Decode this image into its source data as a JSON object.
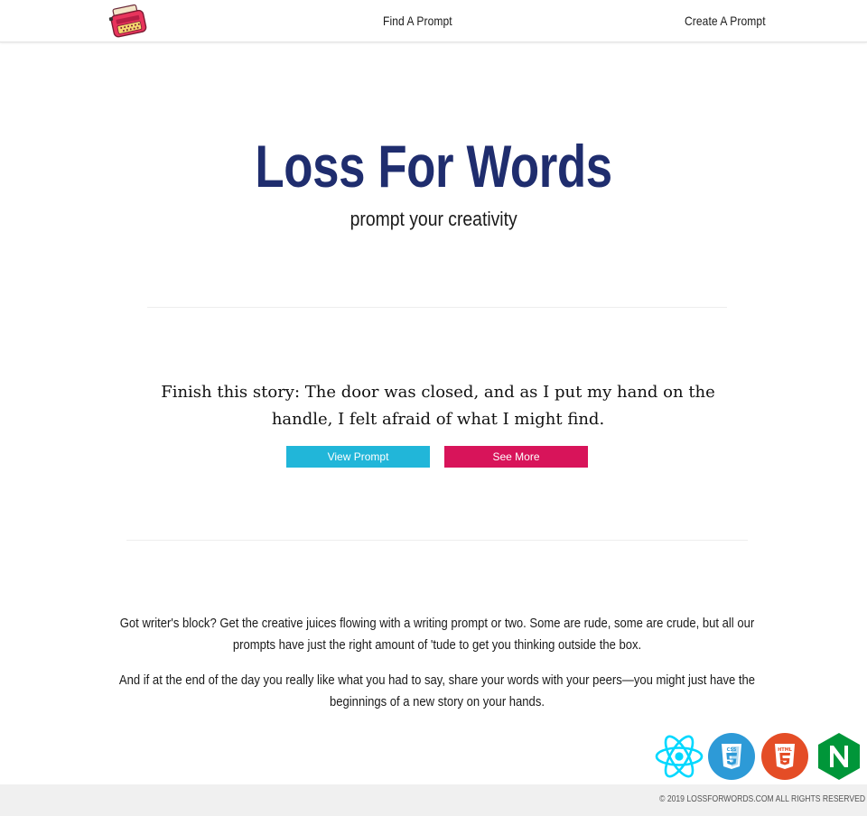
{
  "nav": {
    "logo_icon": "typewriter-icon",
    "find_label": "Find A Prompt",
    "create_label": "Create A Prompt"
  },
  "hero": {
    "title": "Loss For Words",
    "subtitle": "prompt your creativity"
  },
  "prompt": {
    "text": "Finish this story: The door was closed, and as I put my hand on the handle, I felt afraid of what I might find.",
    "view_label": "View Prompt",
    "more_label": "See More"
  },
  "about": {
    "paragraph_1": "Got writer's block? Get the creative juices flowing with a writing prompt or two. Some are rude, some are crude, but all our prompts have just the right amount of 'tude to get you thinking outside the box.",
    "paragraph_2": "And if at the end of the day you really like what you had to say, share your words with your peers—you might just have the beginnings of a new story on your hands."
  },
  "tech": {
    "icons": [
      "react-icon",
      "css3-icon",
      "html5-icon",
      "nginx-icon"
    ],
    "css_badge": "CSS",
    "html_badge": "HTML"
  },
  "footer": {
    "copyright": "© 2019 LOSSFORWORDS.COM ALL RIGHTS RESERVED"
  },
  "colors": {
    "title": "#1f2d6e",
    "view_button": "#21b6d9",
    "more_button": "#d8145a",
    "react": "#00d8ff",
    "css3": "#2d9ad7",
    "html5": "#e44d26",
    "nginx": "#009639"
  }
}
